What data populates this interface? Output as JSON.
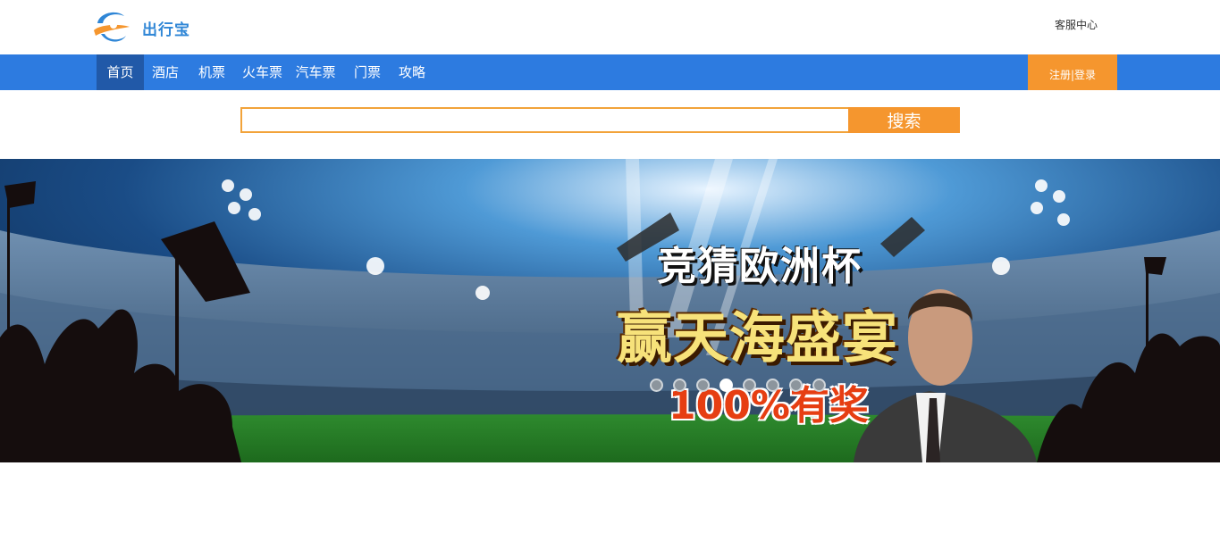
{
  "header": {
    "logo_text": "出行宝",
    "service_link": "客服中心"
  },
  "nav": {
    "items": [
      {
        "label": "首页",
        "active": true
      },
      {
        "label": "酒店",
        "active": false
      },
      {
        "label": "机票",
        "active": false
      },
      {
        "label": "火车票",
        "active": false
      },
      {
        "label": "汽车票",
        "active": false
      },
      {
        "label": "门票",
        "active": false
      },
      {
        "label": "攻略",
        "active": false
      }
    ],
    "auth_label": "注册|登录"
  },
  "search": {
    "value": "",
    "placeholder": "",
    "button_label": "搜索"
  },
  "banner": {
    "line1": "竞猜欧洲杯",
    "line2": "赢天海盛宴",
    "line3": "100%有奖",
    "slide_count": 8,
    "active_slide": 3
  },
  "colors": {
    "nav_bg": "#2d7be0",
    "nav_active": "#2159a8",
    "accent_orange": "#f5962e",
    "logo_blue": "#2f86d6"
  }
}
